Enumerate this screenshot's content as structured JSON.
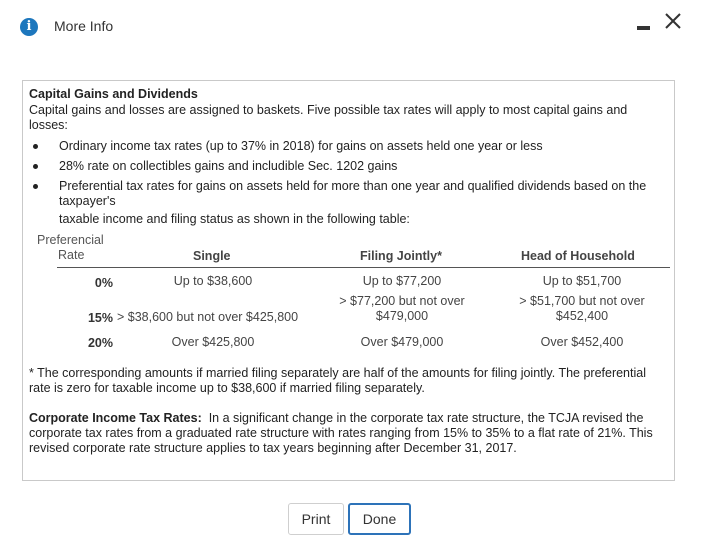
{
  "window": {
    "title": "More Info",
    "info_icon": "i",
    "accent": "#1d77bd"
  },
  "content": {
    "section_title": "Capital Gains and Dividends",
    "intro": "Capital gains and losses are assigned to baskets. Five possible tax rates will apply to most capital gains and losses:",
    "bullets": [
      "Ordinary income tax rates (up to 37% in 2018) for gains on assets held one year or less",
      "28% rate on collectibles gains and includible Sec. 1202 gains",
      "Preferential tax rates for gains on assets held for more than one year and qualified dividends based on the taxpayer's"
    ],
    "after_bullets": "taxable income and filing status as shown in the following table:",
    "table": {
      "rate_header_line1": "Preferencial",
      "rate_header_line2": "Rate",
      "headers": [
        "Single",
        "Filing Jointly*",
        "Head of Household"
      ],
      "rows": [
        {
          "rate": "0%",
          "single": "Up to $38,600",
          "jointly": "Up to $77,200",
          "hoh": "Up to $51,700"
        },
        {
          "rate": "15%",
          "single": "> $38,600 but not over $425,800",
          "jointly_l1": "> $77,200 but not over",
          "jointly_l2": "$479,000",
          "hoh_l1": "> $51,700 but not over",
          "hoh_l2": "$452,400"
        },
        {
          "rate": "20%",
          "single": "Over $425,800",
          "jointly": "Over $479,000",
          "hoh": "Over $452,400"
        }
      ]
    },
    "footnote": "* The corresponding amounts if married filing separately are half of the amounts for filing jointly. The preferential rate is zero for taxable income up to $38,600 if married filing separately.",
    "corporate_label": "Corporate Income Tax Rates:",
    "corporate_text": "In a significant change in the corporate tax rate structure, the TCJA revised the corporate tax rates from a graduated rate structure with rates ranging from 15% to 35% to a flat rate of 21%. This revised corporate rate structure applies to tax years beginning after December 31, 2017."
  },
  "buttons": {
    "print": "Print",
    "done": "Done"
  }
}
